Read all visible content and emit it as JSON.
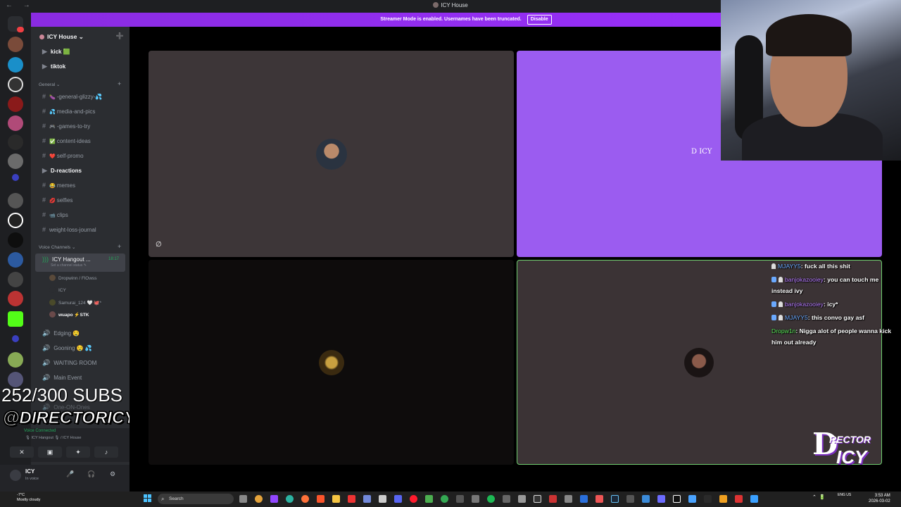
{
  "window": {
    "title": "ICY House",
    "nav": "← →"
  },
  "banner": {
    "text": "Streamer Mode is enabled. Usernames have been truncated.",
    "disable_label": "Disable"
  },
  "server": {
    "name": "ICY House ⌄",
    "invite_icon": "add-member-icon"
  },
  "channels": {
    "top": [
      {
        "label": "kick 🟩"
      },
      {
        "label": "tiktok"
      }
    ],
    "general_category": "General ⌄",
    "text": [
      {
        "label": "-general-glizzy-💦",
        "emoji": "🍆"
      },
      {
        "label": "media-and-pics",
        "emoji": "💦"
      },
      {
        "label": "-games-to-try",
        "emoji": "🎮"
      },
      {
        "label": "content-ideas",
        "emoji": "✅"
      },
      {
        "label": "self-promo",
        "emoji": "❤️"
      },
      {
        "label": "D-reactions",
        "emoji": ""
      },
      {
        "label": "memes",
        "emoji": "😂"
      },
      {
        "label": "selfies",
        "emoji": "💋"
      },
      {
        "label": "clips",
        "emoji": "📹"
      },
      {
        "label": "weight-loss-journal",
        "emoji": ""
      }
    ],
    "voice_category": "Voice Channels ⌄",
    "active_voice": {
      "label": "ICY Hangout ...",
      "time": "18:17",
      "status": "Set a channel status ✎"
    },
    "voice_users": [
      {
        "label": "Dropwinn / FlOwss"
      },
      {
        "label": "ICY"
      },
      {
        "label": "Samurai_124 🤍 🐙*"
      },
      {
        "label": "wuapo ⚡STK"
      }
    ],
    "voice_more": [
      {
        "label": "Edging 🤤"
      },
      {
        "label": "Gooning 🤤 💦"
      },
      {
        "label": "WAITING ROOM"
      },
      {
        "label": "Main Event"
      },
      {
        "label": "One-ON-Ones"
      }
    ]
  },
  "overlay": {
    "subs": "252/300 SUBS",
    "handle": "@DIRECTORICY"
  },
  "voice_panel": {
    "status": "Voice Connected",
    "sub": "🎙 ICY Hangout 🎙 / ICY House"
  },
  "user": {
    "name": "ICY",
    "status": "In voice"
  },
  "stage": {
    "tile2_label": "D ICY"
  },
  "chat": [
    {
      "user": "MJAYY5",
      "color": "#6aa9ff",
      "text": ": fuck all this shit",
      "badges": 1
    },
    {
      "user": "banjokazooiey",
      "color": "#b67cff",
      "text": ": you can touch me instead ivy",
      "badges": 2
    },
    {
      "user": "banjokazooiey",
      "color": "#b67cff",
      "text": ": icy*",
      "badges": 2
    },
    {
      "user": "MJAYY5",
      "color": "#6aa9ff",
      "text": ": this convo gay asf",
      "badges": 2
    },
    {
      "user": "Dropw1n",
      "color": "#58e858",
      "text": ": Nigga alot of people wanna kick him out already",
      "badges": 0
    }
  ],
  "logo": {
    "big": "D",
    "top": "RECTOR",
    "bottom": "ICY"
  },
  "taskbar": {
    "weather_temp": "-7°C",
    "weather_desc": "Mostly cloudy",
    "search": "Search",
    "lang": "ENG\nUS",
    "time": "3:53 AM",
    "date": "2026-03-02"
  },
  "colors": {
    "accent": "#5865f2",
    "banner": "#9b30ff",
    "speaking": "#6fcf6f",
    "tile_purple": "#9b5cf0"
  }
}
